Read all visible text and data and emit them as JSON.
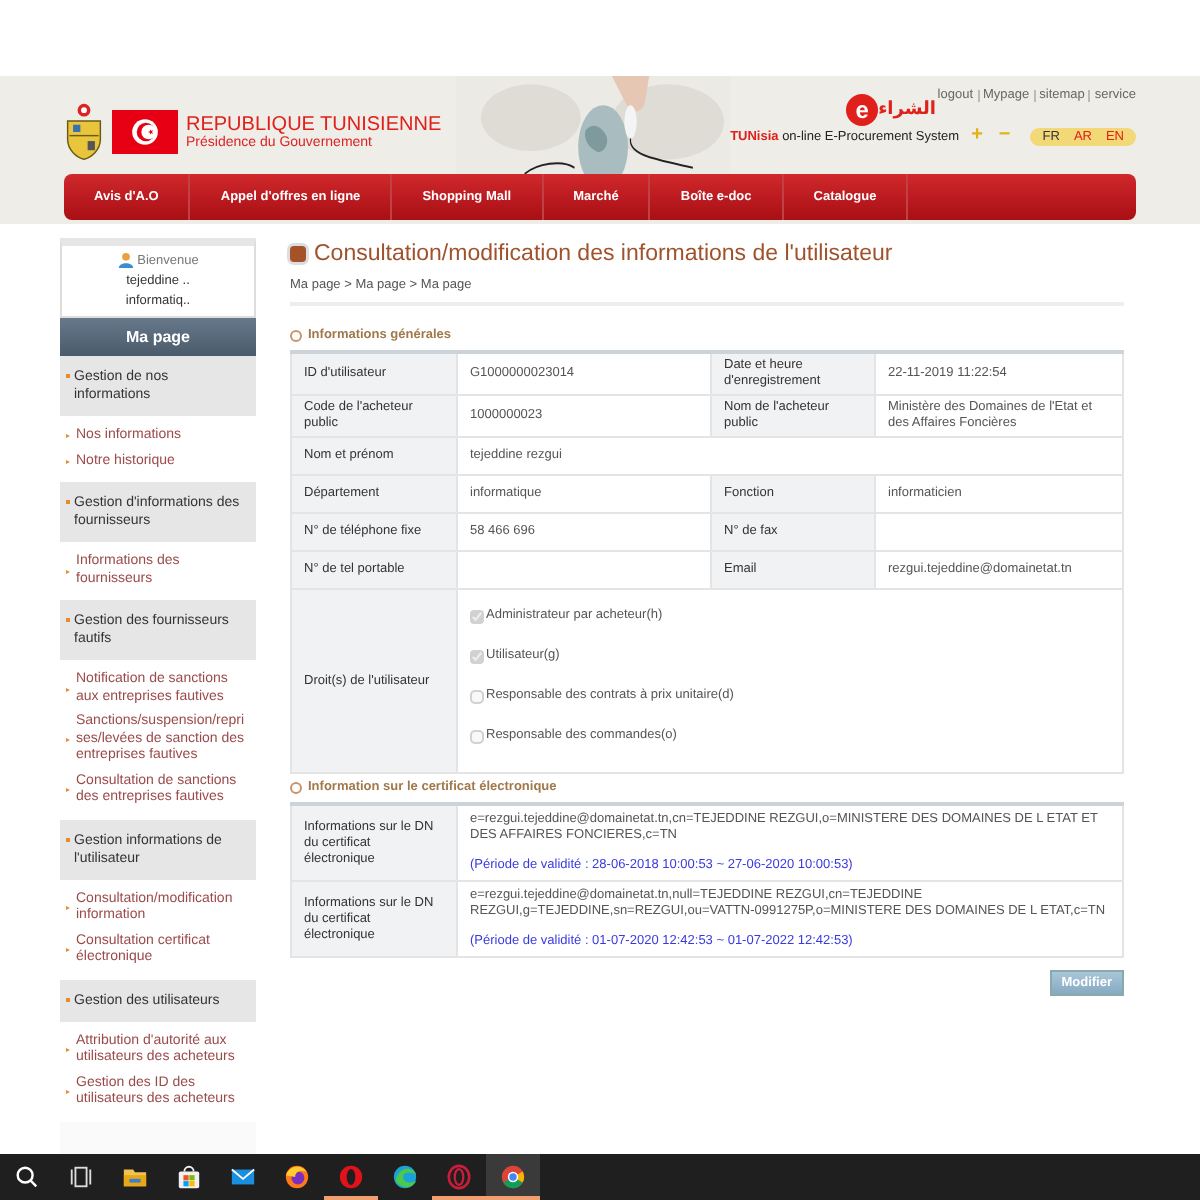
{
  "header": {
    "country": "REPUBLIQUE TUNISIENNE",
    "office": "Présidence du Gouvernement",
    "top_links": [
      "logout",
      "Mypage",
      "sitemap",
      "service"
    ],
    "logo": {
      "mark": "e",
      "text": "الشراء"
    },
    "tagline": {
      "highlight": "TUNisia",
      "rest": "on-line E-Procurement System"
    },
    "zoom": [
      "+",
      "−"
    ],
    "languages": [
      {
        "label": "FR",
        "selected": true
      },
      {
        "label": "AR",
        "selected": false
      },
      {
        "label": "EN",
        "selected": false
      }
    ]
  },
  "nav": [
    "Avis d'A.O",
    "Appel d'offres en ligne",
    "Shopping Mall",
    "Marché",
    "Boîte e-doc",
    "Catalogue"
  ],
  "sidebar": {
    "welcome": "Bienvenue",
    "user": "tejeddine ..",
    "department": "informatiq..",
    "heading": "Ma page",
    "groups": [
      {
        "title": "Gestion de nos informations",
        "items": [
          "Nos informations",
          "Notre historique"
        ]
      },
      {
        "title": "Gestion d'informations des fournisseurs",
        "items": [
          "Informations des fournisseurs"
        ]
      },
      {
        "title": "Gestion des fournisseurs fautifs",
        "items": [
          "Notification de sanctions aux entreprises fautives",
          "Sanctions/suspension/reprises/levées de sanction des entreprises fautives",
          "Consultation de sanctions des entreprises fautives"
        ]
      },
      {
        "title": "Gestion informations de l'utilisateur",
        "items": [
          "Consultation/modification information",
          "Consultation certificat électronique"
        ]
      },
      {
        "title": "Gestion des utilisateurs",
        "items": [
          "Attribution d'autorité aux utilisateurs des acheteurs",
          "Gestion des ID des utilisateurs des acheteurs"
        ]
      }
    ]
  },
  "page": {
    "title": "Consultation/modification des informations de l'utilisateur",
    "breadcrumb": "Ma page > Ma page > Ma page",
    "general": {
      "heading": "Informations générales",
      "rows": [
        [
          {
            "label": "ID d'utilisateur",
            "value": "G1000000023014"
          },
          {
            "label": "Date et heure d'enregistrement",
            "value": "22-11-2019 11:22:54"
          }
        ],
        [
          {
            "label": "Code de l'acheteur public",
            "value": "1000000023"
          },
          {
            "label": "Nom de l'acheteur public",
            "value": "Ministère des Domaines de l'Etat et des Affaires Foncières"
          }
        ],
        [
          {
            "label": "Nom et prénom",
            "value": "tejeddine rezgui"
          }
        ],
        [
          {
            "label": "Département",
            "value": "informatique"
          },
          {
            "label": "Fonction",
            "value": "informaticien"
          }
        ],
        [
          {
            "label": "N° de téléphone fixe",
            "value": "58 466 696"
          },
          {
            "label": "N° de fax"
          }
        ],
        [
          {
            "label": "N° de tel portable"
          },
          {
            "label": "Email",
            "value": "rezgui.tejeddine@domainetat.tn"
          }
        ]
      ],
      "rights": {
        "label": "Droit(s) de l'utilisateur",
        "options": [
          {
            "label": "Administrateur par acheteur(h)",
            "checked": true
          },
          {
            "label": "Utilisateur(g)",
            "checked": true
          },
          {
            "label": "Responsable des contrats à prix unitaire(d)",
            "checked": false
          },
          {
            "label": "Responsable des commandes(o)",
            "checked": false
          }
        ]
      }
    },
    "certificate": {
      "heading": "Information sur le certificat électronique",
      "rows": [
        {
          "label": "Informations sur le DN du certificat électronique",
          "dn": "e=rezgui.tejeddine@domainetat.tn,cn=TEJEDDINE REZGUI,o=MINISTERE DES DOMAINES DE L ETAT ET DES AFFAIRES FONCIERES,c=TN",
          "validity": "(Période de validité : 28-06-2018 10:00:53 ~ 27-06-2020 10:00:53)"
        },
        {
          "label": "Informations sur le DN du certificat électronique",
          "dn": "e=rezgui.tejeddine@domainetat.tn,null=TEJEDDINE REZGUI,cn=TEJEDDINE REZGUI,g=TEJEDDINE,sn=REZGUI,ou=VATTN-0991275P,o=MINISTERE DES DOMAINES DE L ETAT,c=TN",
          "validity": "(Période de validité : 01-07-2020 12:42:53 ~ 01-07-2022 12:42:53)"
        }
      ]
    },
    "button": "Modifier"
  },
  "taskbar": [
    {
      "kind": "search",
      "running": false,
      "selected": false
    },
    {
      "kind": "taskview",
      "running": false,
      "selected": false
    },
    {
      "kind": "folder",
      "running": false,
      "selected": false
    },
    {
      "kind": "store",
      "running": false,
      "selected": false
    },
    {
      "kind": "mail",
      "running": false,
      "selected": false
    },
    {
      "kind": "firefox",
      "running": false,
      "selected": false
    },
    {
      "kind": "opera",
      "running": true,
      "selected": false
    },
    {
      "kind": "edge",
      "running": false,
      "selected": false
    },
    {
      "kind": "operagx",
      "running": true,
      "selected": false
    },
    {
      "kind": "chrome",
      "running": true,
      "selected": true
    }
  ]
}
